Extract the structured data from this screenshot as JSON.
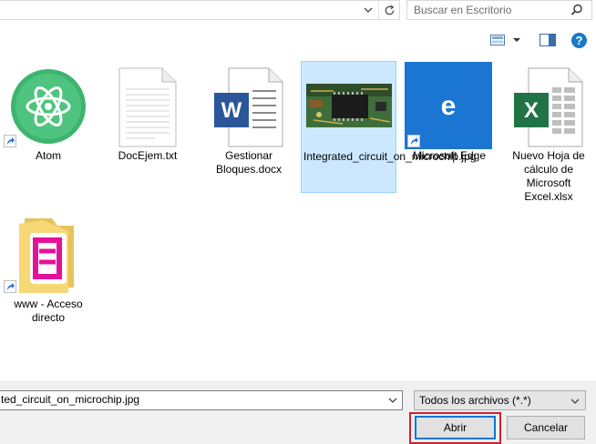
{
  "search": {
    "placeholder": "Buscar en Escritorio"
  },
  "files": [
    {
      "name": "Atom",
      "icon": "atom-app-icon",
      "shortcut": true
    },
    {
      "name": "DocEjem.txt",
      "icon": "text-document-icon"
    },
    {
      "name": "Gestionar Bloques.docx",
      "icon": "word-document-icon"
    },
    {
      "name": "Integrated_circuit_on_microchip.jpg",
      "icon": "image-thumbnail-icon",
      "selected": true
    },
    {
      "name": "Microsoft Edge",
      "icon": "edge-app-icon",
      "shortcut": true
    },
    {
      "name": "Nuevo Hoja de cálculo de Microsoft Excel.xlsx",
      "icon": "excel-document-icon"
    },
    {
      "name": "www - Acceso directo",
      "icon": "folder-shortcut-icon",
      "shortcut": true
    }
  ],
  "filename": {
    "value": "ted_circuit_on_microchip.jpg"
  },
  "filter": {
    "selected": "Todos los archivos (*.*)"
  },
  "buttons": {
    "open": "Abrir",
    "cancel": "Cancelar"
  },
  "colors": {
    "selection": "#cce8ff",
    "accent": "#0078d7",
    "highlight": "#d42030",
    "help": "#1979ca"
  }
}
